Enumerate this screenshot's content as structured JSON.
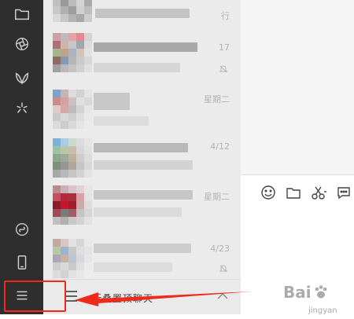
{
  "chat_list": {
    "rows": [
      {
        "time": "行"
      },
      {
        "time": "17",
        "muted": true
      },
      {
        "time": "星期二"
      },
      {
        "time": "4/12"
      },
      {
        "time": "星期二"
      },
      {
        "time": "4/23",
        "muted": true
      }
    ],
    "footer_label": "折叠置顶聊天"
  },
  "nav_icons": [
    "folder-icon",
    "aperture-icon",
    "butterfly-icon",
    "spark-icon",
    "mini-program-icon",
    "phone-icon",
    "menu-icon"
  ],
  "toolbar_icons": [
    "emoji-icon",
    "folder-icon",
    "scissors-icon",
    "chat-bubble-icon"
  ],
  "watermark": {
    "brand": "Bai",
    "sub": "jingyan"
  },
  "colors": {
    "sidebar": "#2e2e2e",
    "list_bg": "#ebebeb",
    "annotation": "#ee2a1b"
  }
}
